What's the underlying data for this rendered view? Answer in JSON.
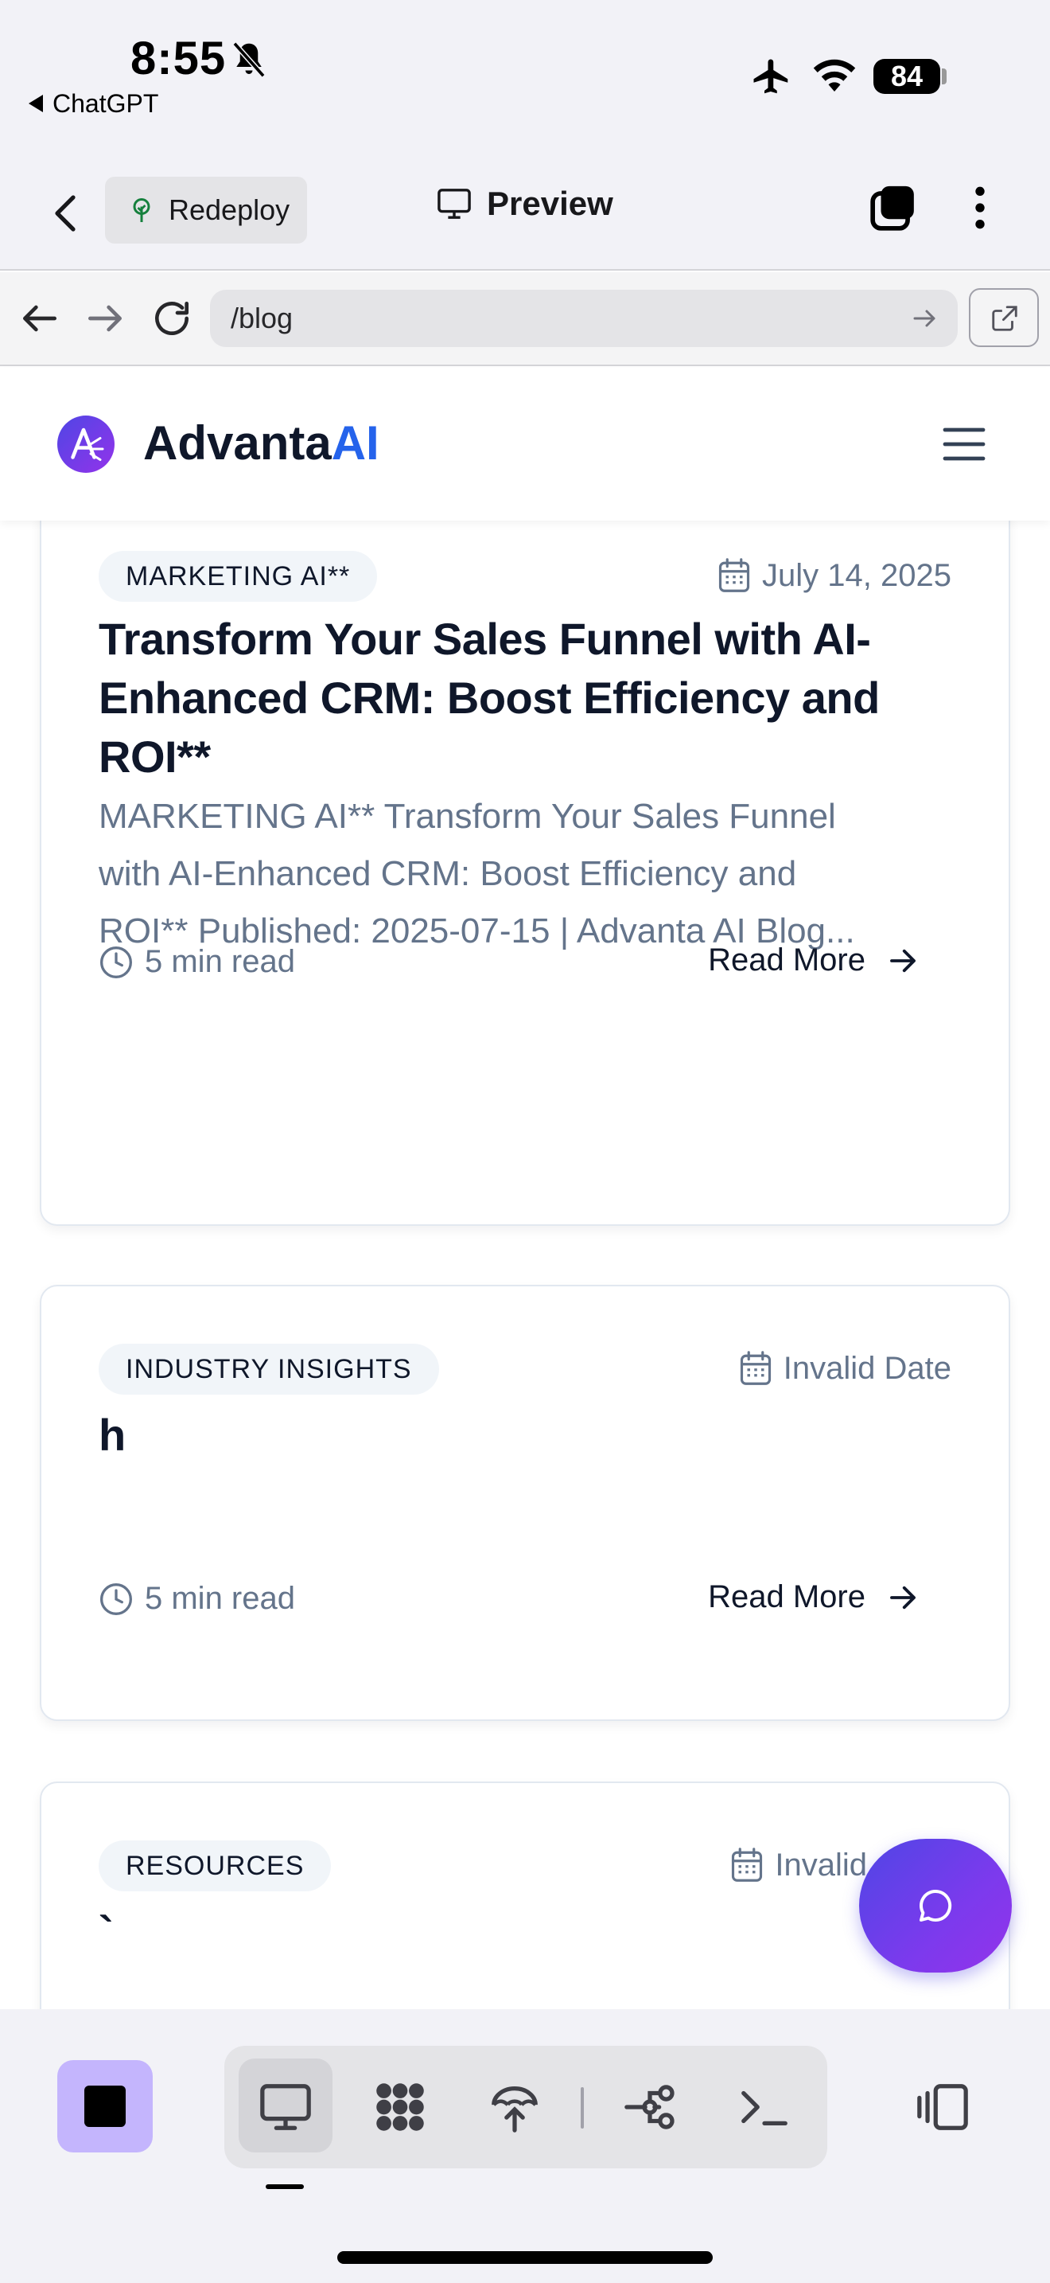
{
  "status_bar": {
    "time": "8:55",
    "back_app": "ChatGPT",
    "battery": "84",
    "icons": [
      "bell-slash-icon",
      "airplane-icon",
      "wifi-icon",
      "battery-icon"
    ]
  },
  "app_header": {
    "redeploy_label": "Redeploy",
    "preview_label": "Preview"
  },
  "browser": {
    "url": "/blog"
  },
  "site": {
    "brand_main": "Advanta",
    "brand_accent": "AI",
    "colors": {
      "brand_accent": "#2563eb",
      "fab_start": "#4f46e5",
      "fab_end": "#9333ea",
      "stop_button": "#c4b5fd"
    }
  },
  "posts": [
    {
      "category": "MARKETING AI**",
      "date": "July 14, 2025",
      "title_lines": [
        "Transform Your Sales Funnel with AI-",
        "Enhanced CRM: Boost Efficiency and",
        "ROI**"
      ],
      "excerpt_lines": [
        "MARKETING AI** Transform Your Sales Funnel",
        "with AI-Enhanced CRM: Boost Efficiency and",
        "ROI** Published: 2025-07-15 | Advanta AI Blog..."
      ],
      "read_time": "5 min read",
      "read_more": "Read More"
    },
    {
      "category": "INDUSTRY INSIGHTS",
      "date": "Invalid Date",
      "title": "h",
      "read_time": "5 min read",
      "read_more": "Read More"
    },
    {
      "category": "RESOURCES",
      "date": "Invalid",
      "title": "`"
    }
  ]
}
